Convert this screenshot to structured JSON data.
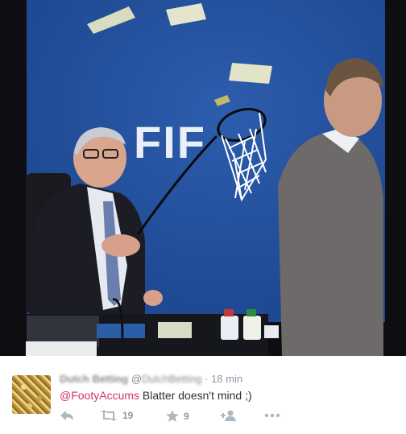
{
  "photo": {
    "sign_text": "FIF",
    "icon": "photo-scene"
  },
  "tweet": {
    "name": "Dutch Betting",
    "handle_prefix": "@",
    "handle_blurred": "DutchBetting",
    "separator": "·",
    "time": "18 min",
    "mention": "@FootyAccums",
    "text": " Blatter doesn't mind ;)",
    "actions": {
      "reply_icon": "reply-icon",
      "retweet_icon": "retweet-icon",
      "retweet_count": "19",
      "favorite_icon": "star-icon",
      "favorite_count": "9",
      "follow_icon": "follow-icon",
      "more_icon": "more-icon"
    },
    "colors": {
      "mention": "#d0345c",
      "action_gray": "#aab8c2",
      "text": "#292f33"
    }
  }
}
